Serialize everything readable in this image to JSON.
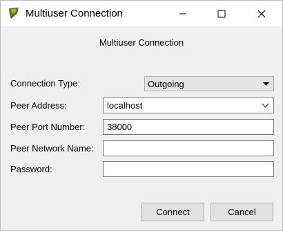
{
  "window": {
    "title": "Multiuser Connection"
  },
  "titlebar_buttons": {
    "minimize": "minimize-icon",
    "maximize": "maximize-icon",
    "close": "close-icon"
  },
  "dialog": {
    "heading": "Multiuser Connection",
    "fields": {
      "connection_type": {
        "label": "Connection Type:",
        "value": "Outgoing"
      },
      "peer_address": {
        "label": "Peer Address:",
        "value": "localhost"
      },
      "peer_port": {
        "label": "Peer Port Number:",
        "value": "38000"
      },
      "peer_network_name": {
        "label": "Peer Network Name:",
        "value": ""
      },
      "password": {
        "label": "Password:",
        "value": ""
      }
    },
    "buttons": {
      "connect": "Connect",
      "cancel": "Cancel"
    }
  },
  "colors": {
    "window_bg": "#f0f0f0",
    "titlebar_bg": "#ffffff",
    "button_bg": "#e1e1e1",
    "field_border": "#7a7a7a"
  }
}
